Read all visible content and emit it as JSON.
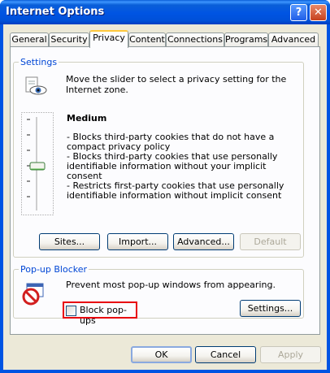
{
  "window": {
    "title": "Internet Options",
    "help_glyph": "?",
    "close_glyph": "✕"
  },
  "tabs": [
    {
      "label": "General",
      "active": false
    },
    {
      "label": "Security",
      "active": false
    },
    {
      "label": "Privacy",
      "active": true
    },
    {
      "label": "Content",
      "active": false
    },
    {
      "label": "Connections",
      "active": false
    },
    {
      "label": "Programs",
      "active": false
    },
    {
      "label": "Advanced",
      "active": false
    }
  ],
  "settings": {
    "group_label": "Settings",
    "intro": "Move the slider to select a privacy setting for the Internet zone.",
    "level": "Medium",
    "description": "- Blocks third-party cookies that do not have a compact privacy policy\n- Blocks third-party cookies that use personally identifiable information without your implicit consent\n- Restricts first-party cookies that use personally identifiable information without implicit consent",
    "buttons": {
      "sites": "Sites...",
      "import": "Import...",
      "advanced": "Advanced...",
      "default": "Default"
    }
  },
  "popup_blocker": {
    "group_label": "Pop-up Blocker",
    "text": "Prevent most pop-up windows from appearing.",
    "checkbox_label": "Block pop-ups",
    "checked": false,
    "settings_button": "Settings..."
  },
  "dialog_buttons": {
    "ok": "OK",
    "cancel": "Cancel",
    "apply": "Apply"
  },
  "colors": {
    "titlebar": "#0054e3",
    "group_label": "#0046d5",
    "highlight_box": "#e8000c",
    "dialog_face": "#ece9d8"
  }
}
